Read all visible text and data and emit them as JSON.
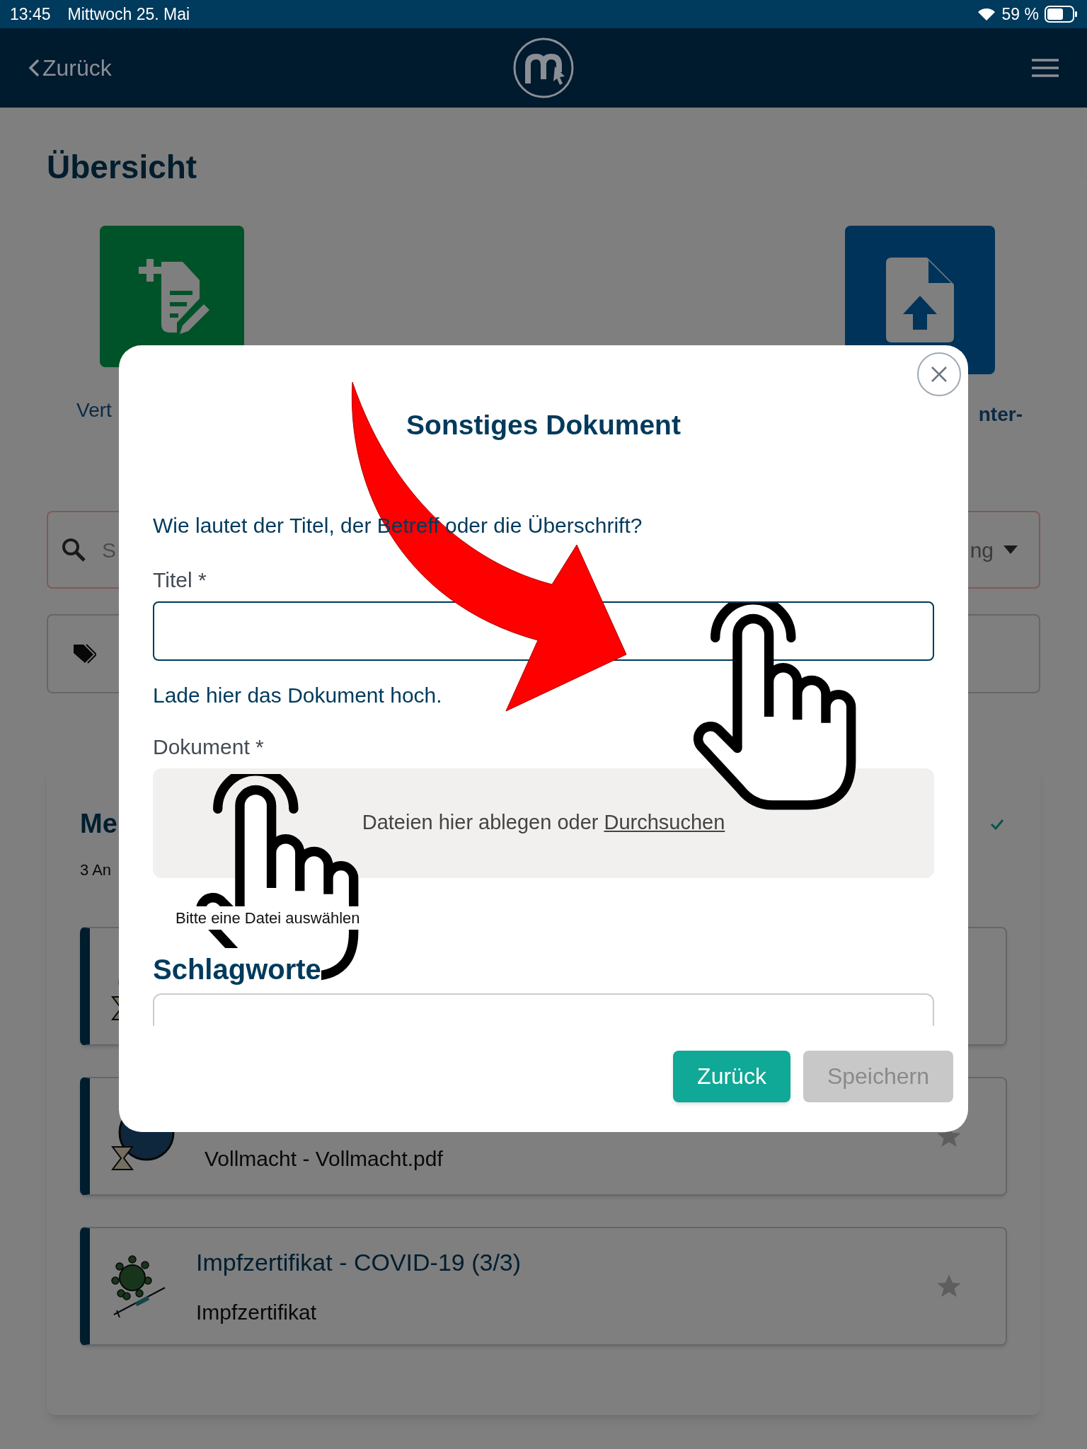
{
  "status_bar": {
    "time": "13:45",
    "date": "Mittwoch 25. Mai",
    "battery": "59 %"
  },
  "nav": {
    "back": "Zurück"
  },
  "page": {
    "title": "Übersicht",
    "tiles": [
      {
        "kind": "new",
        "label": "Vert"
      },
      {
        "kind": "upload",
        "label": "nter-"
      }
    ],
    "search": {
      "placeholder": "S",
      "sort": "ng"
    },
    "panel": {
      "title": "Me",
      "subtitle": "3 An",
      "documents": [
        {
          "kind": "hourglass"
        },
        {
          "kind": "hourglass",
          "star": true,
          "subtitle": "Vollmacht - Vollmacht.pdf"
        },
        {
          "kind": "virus",
          "star": true,
          "title": "Impfzertifikat - COVID-19 (3/3)",
          "subtitle": "Impfzertifikat"
        }
      ]
    }
  },
  "dialog": {
    "title": "Sonstiges Dokument",
    "question": "Wie lautet der Titel, der Betreff oder die Überschrift?",
    "title_field": {
      "label": "Titel *"
    },
    "upload_hint": "Lade hier das Dokument hoch.",
    "document_field": {
      "label": "Dokument *",
      "drop_text": "Dateien hier ablegen oder",
      "browse": "Durchsuchen",
      "error": "Bitte eine Datei auswählen"
    },
    "tags_heading": "Schlagworte",
    "buttons": [
      {
        "label": "Zurück",
        "disabled": false
      },
      {
        "label": "Speichern",
        "disabled": true
      }
    ]
  }
}
